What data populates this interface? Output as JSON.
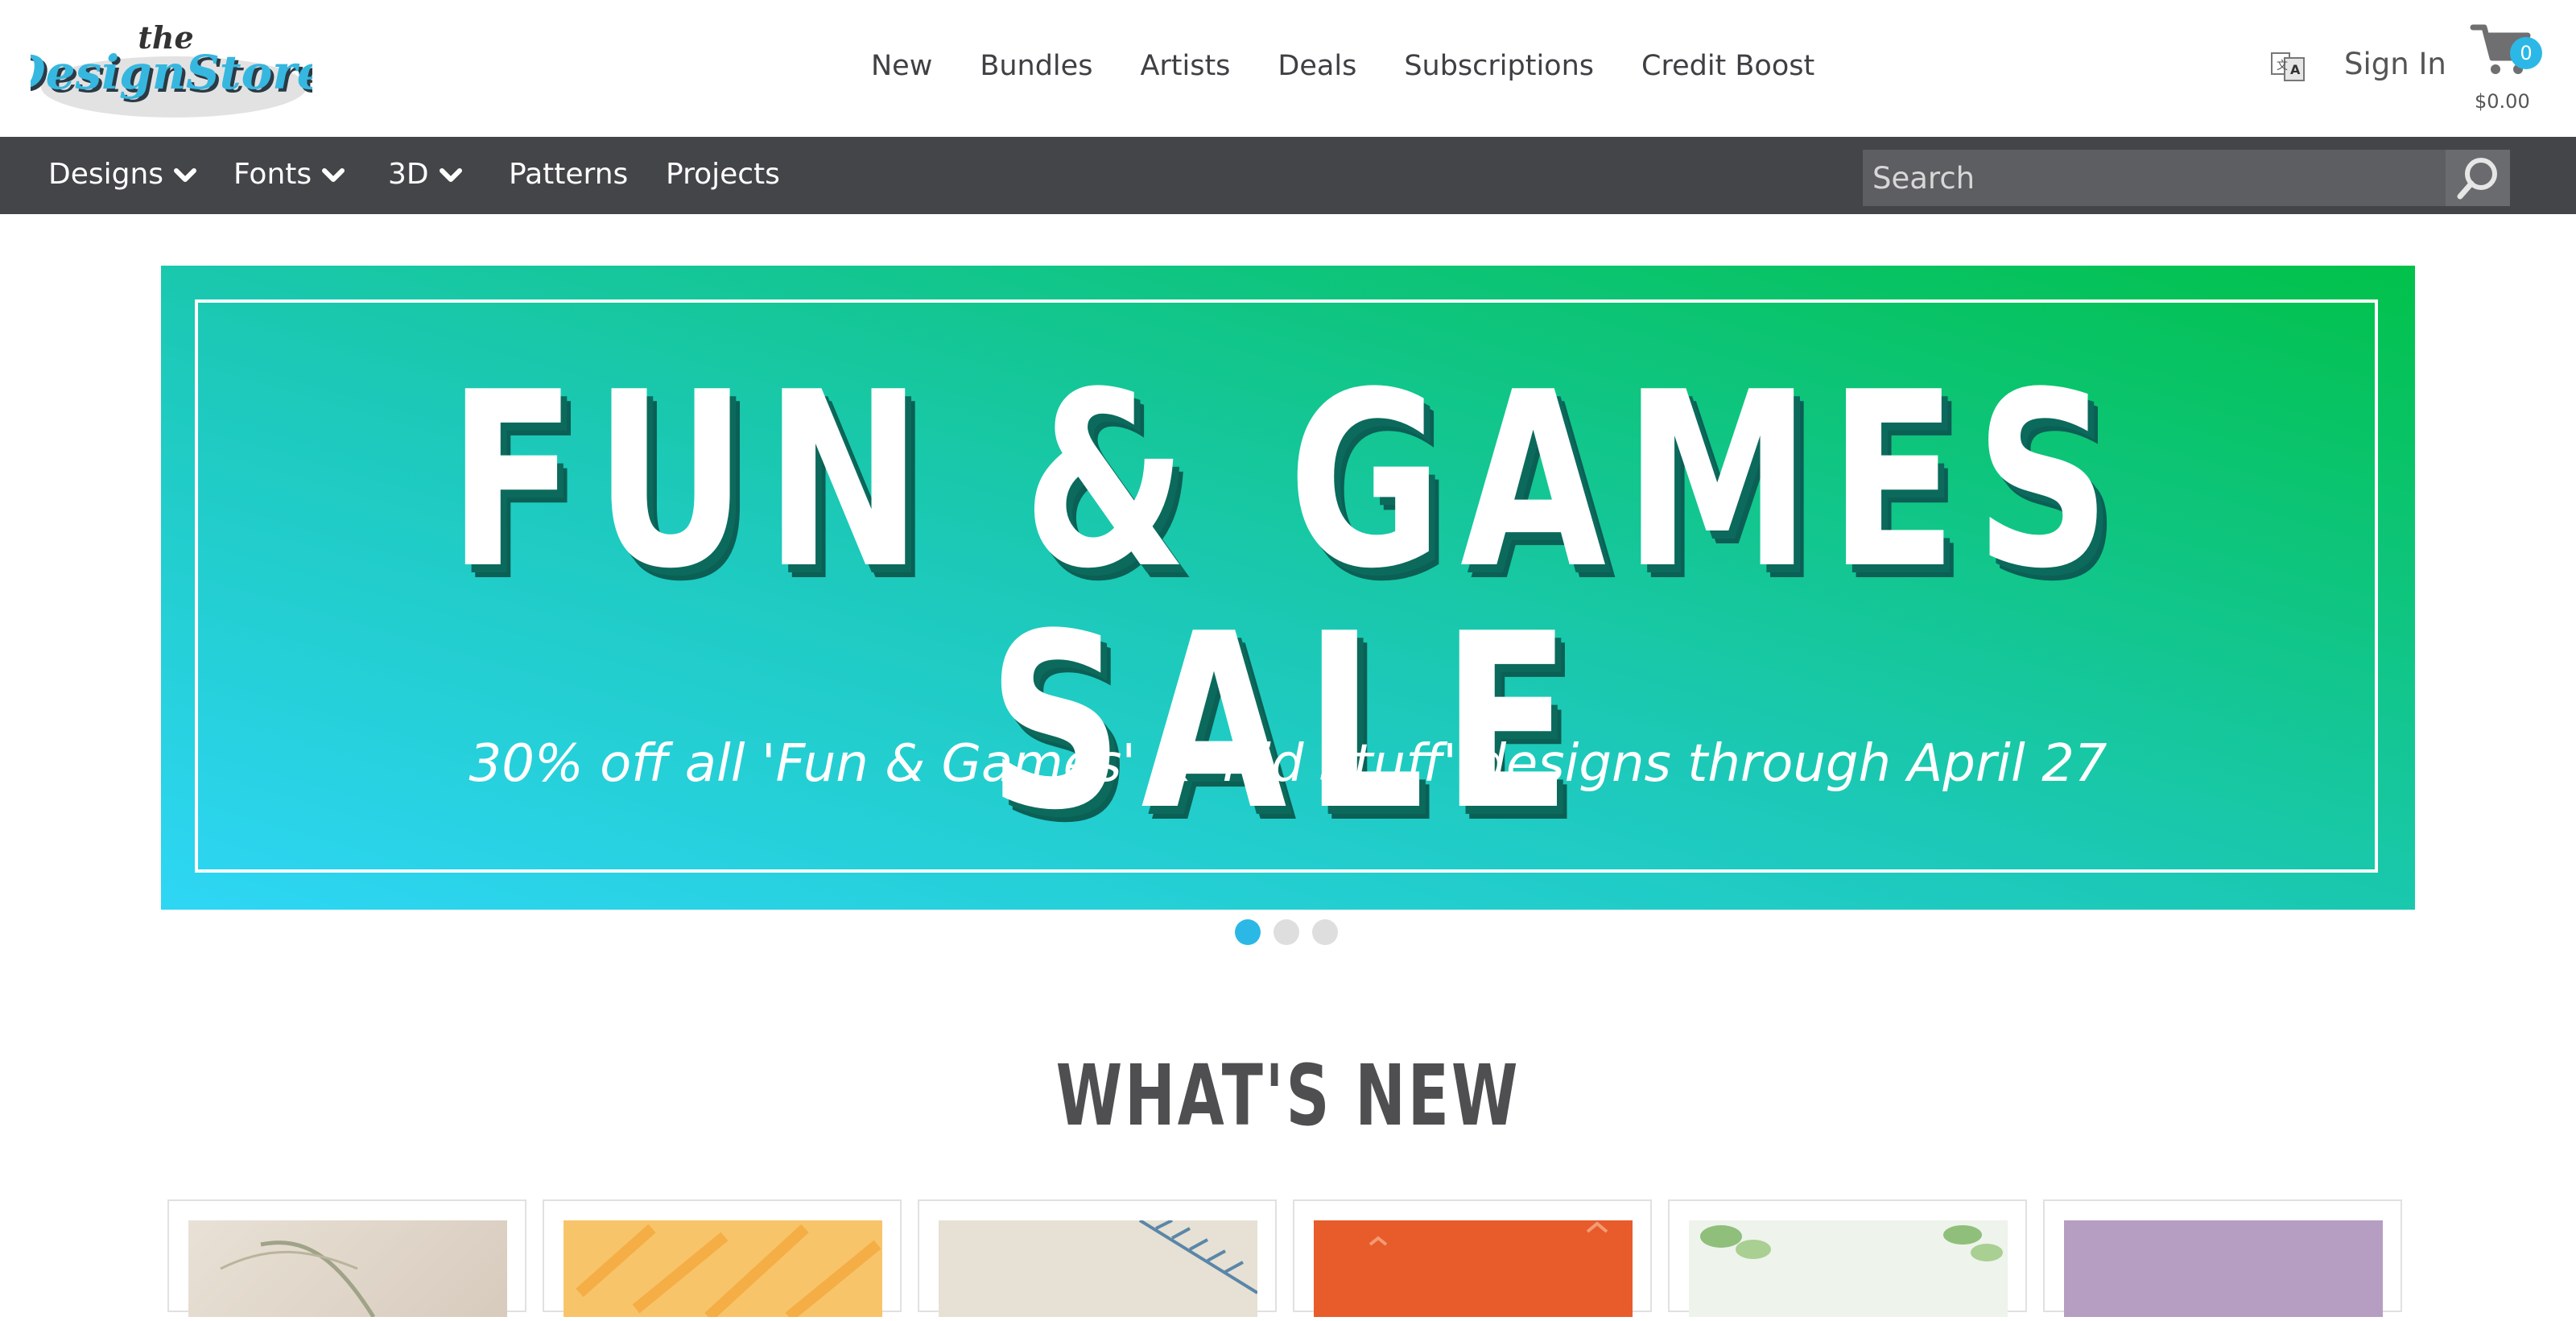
{
  "header": {
    "nav": [
      "New",
      "Bundles",
      "Artists",
      "Deals",
      "Subscriptions",
      "Credit Boost"
    ],
    "sign_in": "Sign In",
    "cart_count": "0",
    "cart_total": "$0.00"
  },
  "subnav": {
    "designs": "Designs",
    "fonts": "Fonts",
    "three_d": "3D",
    "patterns": "Patterns",
    "projects": "Projects"
  },
  "search": {
    "placeholder": "Search"
  },
  "banner": {
    "title": "FUN & GAMES SALE",
    "subtitle": "30% off all 'Fun & Games' & 'Kid Stuff' designs through April 27"
  },
  "section": {
    "title": "WHAT'S NEW"
  },
  "colors": {
    "accent": "#2bb8e6",
    "subnav_bg": "#444548",
    "banner_start": "#2ed6f5",
    "banner_end": "#02c14a"
  }
}
